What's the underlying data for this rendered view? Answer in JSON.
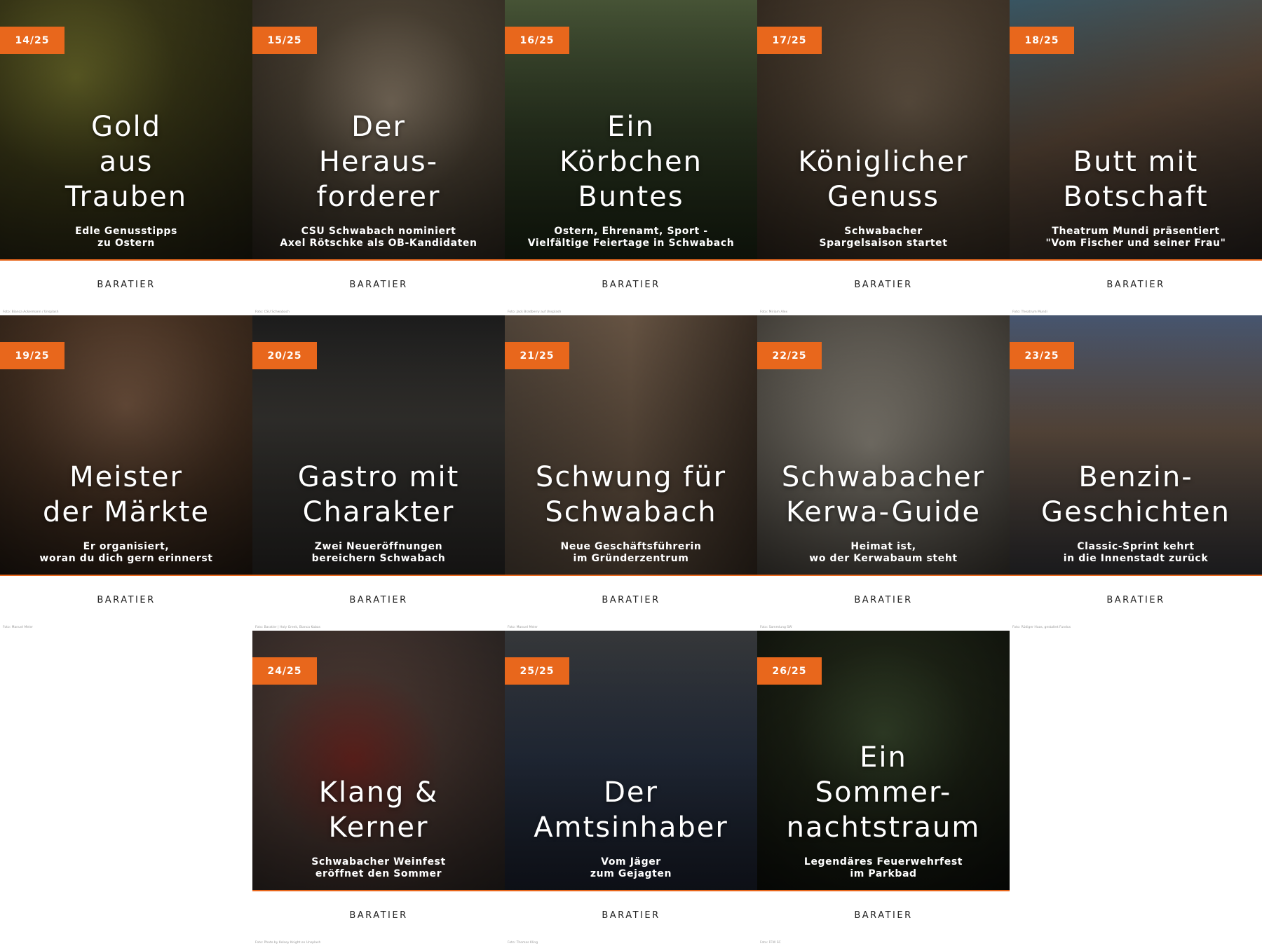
{
  "brand_label": "BARATIER",
  "accent_color": "#e8671c",
  "tiles": [
    {
      "badge": "14/25",
      "title": "Gold\naus\nTrauben",
      "subtitle": "Edle Genusstipps\nzu Ostern",
      "credit": "Foto: Bianca Ackermann / Unsplash"
    },
    {
      "badge": "15/25",
      "title": "Der\nHeraus-\nforderer",
      "subtitle": "CSU Schwabach nominiert\nAxel Rötschke als OB-Kandidaten",
      "credit": "Foto: CSU Schwabach"
    },
    {
      "badge": "16/25",
      "title": "Ein\nKörbchen\nBuntes",
      "subtitle": "Ostern, Ehrenamt, Sport -\nVielfältige Feiertage in Schwabach",
      "credit": "Foto: Jack Bradberry auf Unsplash"
    },
    {
      "badge": "17/25",
      "title": "Königlicher\nGenuss",
      "subtitle": "Schwabacher\nSpargelsaison startet",
      "credit": "Foto: Miriam Alex"
    },
    {
      "badge": "18/25",
      "title": "Butt mit\nBotschaft",
      "subtitle": "Theatrum Mundi präsentiert\n\"Vom Fischer und seiner Frau\"",
      "credit": "Foto: Theatrum Mundi"
    },
    {
      "badge": "19/25",
      "title": "Meister\nder Märkte",
      "subtitle": "Er organisiert,\nworan du dich gern erinnerst",
      "credit": "Foto: Manuel Meier"
    },
    {
      "badge": "20/25",
      "title": "Gastro mit\nCharakter",
      "subtitle": "Zwei Neueröffnungen\nbereichern Schwabach",
      "credit": "Foto: Baratier | Holy Greek, Bianca Kabas"
    },
    {
      "badge": "21/25",
      "title": "Schwung für\nSchwabach",
      "subtitle": "Neue Geschäftsführerin\nim Gründerzentrum",
      "credit": "Foto: Manuel Meier"
    },
    {
      "badge": "22/25",
      "title": "Schwabacher\nKerwa-Guide",
      "subtitle": "Heimat ist,\nwo der Kerwabaum steht",
      "credit": "Foto: Sammlung SW"
    },
    {
      "badge": "23/25",
      "title": "Benzin-\nGeschichten",
      "subtitle": "Classic-Sprint kehrt\nin die Innenstadt zurück",
      "credit": "Foto: Rüdiger Haas, gestaltet Fundus"
    },
    {
      "badge": "24/25",
      "title": "Klang &\nKerner",
      "subtitle": "Schwabacher Weinfest\neröffnet den Sommer",
      "credit": "Foto: Photo by Kelsey Knight on Unsplash"
    },
    {
      "badge": "25/25",
      "title": "Der\nAmtsinhaber",
      "subtitle": "Vom Jäger\nzum Gejagten",
      "credit": "Foto: Thomas Kling"
    },
    {
      "badge": "26/25",
      "title": "Ein\nSommer-\nnachtstraum",
      "subtitle": "Legendäres Feuerwehrfest\nim Parkbad",
      "credit": "Foto: FFW SC"
    }
  ]
}
